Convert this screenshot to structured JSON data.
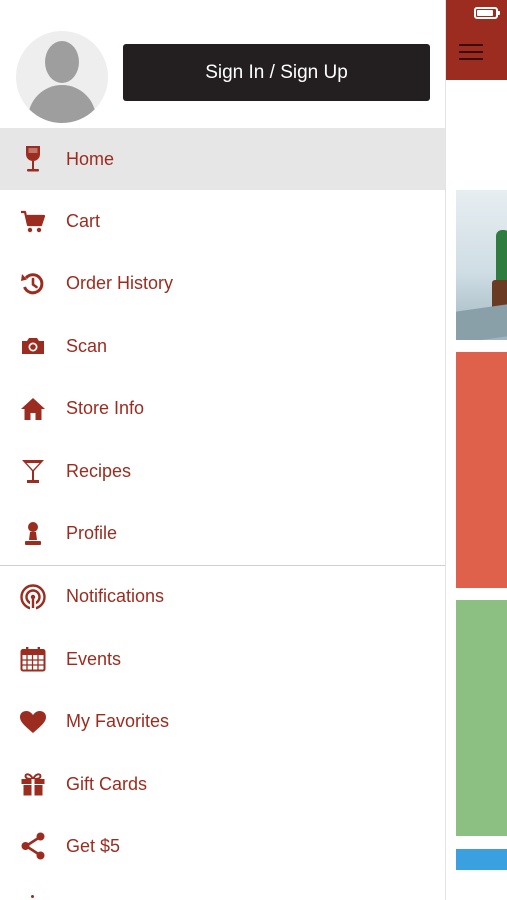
{
  "header": {
    "signin_label": "Sign In / Sign Up"
  },
  "menu": {
    "primary": [
      {
        "label": "Home",
        "icon": "wine-glass-icon",
        "active": true
      },
      {
        "label": "Cart",
        "icon": "cart-icon"
      },
      {
        "label": "Order History",
        "icon": "history-icon"
      },
      {
        "label": "Scan",
        "icon": "camera-icon"
      },
      {
        "label": "Store Info",
        "icon": "home-icon"
      },
      {
        "label": "Recipes",
        "icon": "cocktail-icon"
      },
      {
        "label": "Profile",
        "icon": "person-icon"
      }
    ],
    "secondary": [
      {
        "label": "Notifications",
        "icon": "broadcast-icon"
      },
      {
        "label": "Events",
        "icon": "calendar-icon"
      },
      {
        "label": "My Favorites",
        "icon": "heart-icon"
      },
      {
        "label": "Gift Cards",
        "icon": "gift-icon"
      },
      {
        "label": "Get $5",
        "icon": "share-icon"
      }
    ]
  },
  "colors": {
    "accent": "#9b2c1f",
    "active_row": "#e6e6e6",
    "button_bg": "#231f20"
  }
}
